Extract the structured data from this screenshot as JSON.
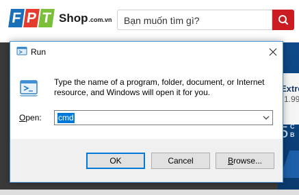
{
  "website": {
    "logo_letters": [
      "F",
      "P",
      "T"
    ],
    "logo_colors": [
      "#1a70b8",
      "#e53b2f",
      "#7bbf3a"
    ],
    "logo_shop": "Shop",
    "logo_domain": ".com.vn",
    "search_placeholder": "Bạn muốn tìm gì?",
    "search_button_color": "#cb1c22",
    "promo_text": "Extre",
    "promo_price": "1.99",
    "promo_big": "5",
    "promo_small_1": "C",
    "promo_small_2": "B"
  },
  "dialog": {
    "title": "Run",
    "close_icon": "close-icon",
    "description": "Type the name of a program, folder, document, or Internet resource, and Windows will open it for you.",
    "open_label_mnemonic": "O",
    "open_label_rest": "pen:",
    "open_value": "cmd",
    "buttons": {
      "ok": "OK",
      "cancel": "Cancel",
      "browse_mnemonic": "B",
      "browse_rest": "rowse..."
    },
    "accent_color": "#0078d7"
  }
}
